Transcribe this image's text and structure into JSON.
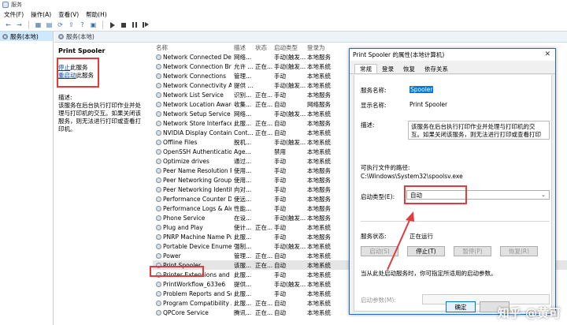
{
  "window": {
    "title": "服务"
  },
  "menu": [
    {
      "label": "文件(F)"
    },
    {
      "label": "操作(A)"
    },
    {
      "label": "查看(V)"
    },
    {
      "label": "帮助(H)"
    }
  ],
  "tree": {
    "root_label": "服务(本地)"
  },
  "main": {
    "header_label": "服务(本地)"
  },
  "detail": {
    "service_title": "Print Spooler",
    "stop_link": "停止",
    "stop_suffix": "此服务",
    "restart_link": "重启动",
    "restart_suffix": "此服务",
    "desc_label": "描述:",
    "description": "该服务在后台执行打印作业并处理与打印机的交互。如果关闭该服务，则无法进行打印或查看打印机。"
  },
  "columns": {
    "name": "名称",
    "desc": "描述",
    "status": "状态",
    "start": "启动类型",
    "logon": "登录为"
  },
  "rows": [
    {
      "name": "Network Connected Devi...",
      "desc": "网络...",
      "status": "",
      "start": "手动(触发...",
      "logon": "本地服务"
    },
    {
      "name": "Network Connection Bro...",
      "desc": "允许 ...",
      "status": "正在...",
      "start": "手动(触发...",
      "logon": "本地系统"
    },
    {
      "name": "Network Connections",
      "desc": "管理...",
      "status": "",
      "start": "手动",
      "logon": "本地系统"
    },
    {
      "name": "Network Connectivity Ass...",
      "desc": "提供 ...",
      "status": "",
      "start": "手动(触发...",
      "logon": "本地系统"
    },
    {
      "name": "Network List Service",
      "desc": "识别...",
      "status": "正在...",
      "start": "手动",
      "logon": "本地服务"
    },
    {
      "name": "Network Location Aware...",
      "desc": "收集...",
      "status": "正在...",
      "start": "自动",
      "logon": "网络服务"
    },
    {
      "name": "Network Setup Service",
      "desc": "网络...",
      "status": "",
      "start": "手动(触发...",
      "logon": "本地系统"
    },
    {
      "name": "Network Store Interface ...",
      "desc": "此服...",
      "status": "正在...",
      "start": "自动",
      "logon": "本地服务"
    },
    {
      "name": "NVIDIA Display Containe...",
      "desc": "Cont...",
      "status": "正在...",
      "start": "自动",
      "logon": "本地系统"
    },
    {
      "name": "Offline Files",
      "desc": "脱机...",
      "status": "",
      "start": "手动(触发...",
      "logon": "本地系统"
    },
    {
      "name": "OpenSSH Authentication ...",
      "desc": "Age...",
      "status": "",
      "start": "禁用",
      "logon": "本地系统"
    },
    {
      "name": "Optimize drives",
      "desc": "通过...",
      "status": "",
      "start": "手动",
      "logon": "本地系统"
    },
    {
      "name": "Peer Name Resolution Pr...",
      "desc": "使用...",
      "status": "",
      "start": "手动",
      "logon": "本地服务"
    },
    {
      "name": "Peer Networking Group...",
      "desc": "使用...",
      "status": "",
      "start": "手动",
      "logon": "本地服务"
    },
    {
      "name": "Peer Networking Identity...",
      "desc": "向对...",
      "status": "",
      "start": "手动",
      "logon": "本地服务"
    },
    {
      "name": "Performance Counter DL...",
      "desc": "使远...",
      "status": "",
      "start": "手动",
      "logon": "本地服务"
    },
    {
      "name": "Performance Logs & Aler...",
      "desc": "性能...",
      "status": "",
      "start": "手动",
      "logon": "本地服务"
    },
    {
      "name": "Phone Service",
      "desc": "在设...",
      "status": "",
      "start": "手动(触发...",
      "logon": "本地服务"
    },
    {
      "name": "Plug and Play",
      "desc": "使计...",
      "status": "正在...",
      "start": "手动",
      "logon": "本地系统"
    },
    {
      "name": "PNRP Machine Name Pu...",
      "desc": "此服...",
      "status": "",
      "start": "手动",
      "logon": "本地服务"
    },
    {
      "name": "Portable Device Enumera...",
      "desc": "强制...",
      "status": "",
      "start": "手动(触发...",
      "logon": "本地系统"
    },
    {
      "name": "Power",
      "desc": "管理...",
      "status": "正在...",
      "start": "自动",
      "logon": "本地系统"
    },
    {
      "name": "Print Spooler",
      "desc": "该服...",
      "status": "正在...",
      "start": "自动",
      "logon": "本地系统"
    },
    {
      "name": "Printer Extensions and N...",
      "desc": "此服...",
      "status": "",
      "start": "手动",
      "logon": "本地系统"
    },
    {
      "name": "PrintWorkflow_633e6",
      "desc": "提供...",
      "status": "",
      "start": "手动(触发...",
      "logon": "本地系统"
    },
    {
      "name": "Problem Reports and So...",
      "desc": "此服...",
      "status": "",
      "start": "手动",
      "logon": "本地系统"
    },
    {
      "name": "Program Compatibility A...",
      "desc": "此服...",
      "status": "正在...",
      "start": "自动",
      "logon": "本地系统"
    },
    {
      "name": "QPCore Service",
      "desc": "腾讯...",
      "status": "正在...",
      "start": "自动",
      "logon": "本地系统"
    }
  ],
  "dialog": {
    "title": "Print Spooler 的属性(本地计算机)",
    "tabs": [
      {
        "label": "常规"
      },
      {
        "label": "登录"
      },
      {
        "label": "恢复"
      },
      {
        "label": "依存关系"
      }
    ],
    "service_name_label": "服务名称:",
    "service_name": "Spooler",
    "display_name_label": "显示名称:",
    "display_name": "Print Spooler",
    "desc_label": "描述:",
    "description": "该服务在后台执行打印作业并处理与打印机的交互。如果关闭该服务，则无法进行打印或查看打印机。",
    "path_label": "可执行文件的路径:",
    "path": "C:\\Windows\\System32\\spoolsv.exe",
    "startup_label": "启动类型(E):",
    "startup_value": "自动",
    "status_label": "服务状态:",
    "status_value": "正在运行",
    "btn_start": "启动(S)",
    "btn_stop": "停止(T)",
    "btn_pause": "暂停(P)",
    "btn_resume": "恢复(R)",
    "hint": "当从此处启动服务时，你可指定所适用的启动参数。",
    "param_label": "启动参数(M):",
    "ok": "确定"
  },
  "watermark": "知乎 @黄可"
}
